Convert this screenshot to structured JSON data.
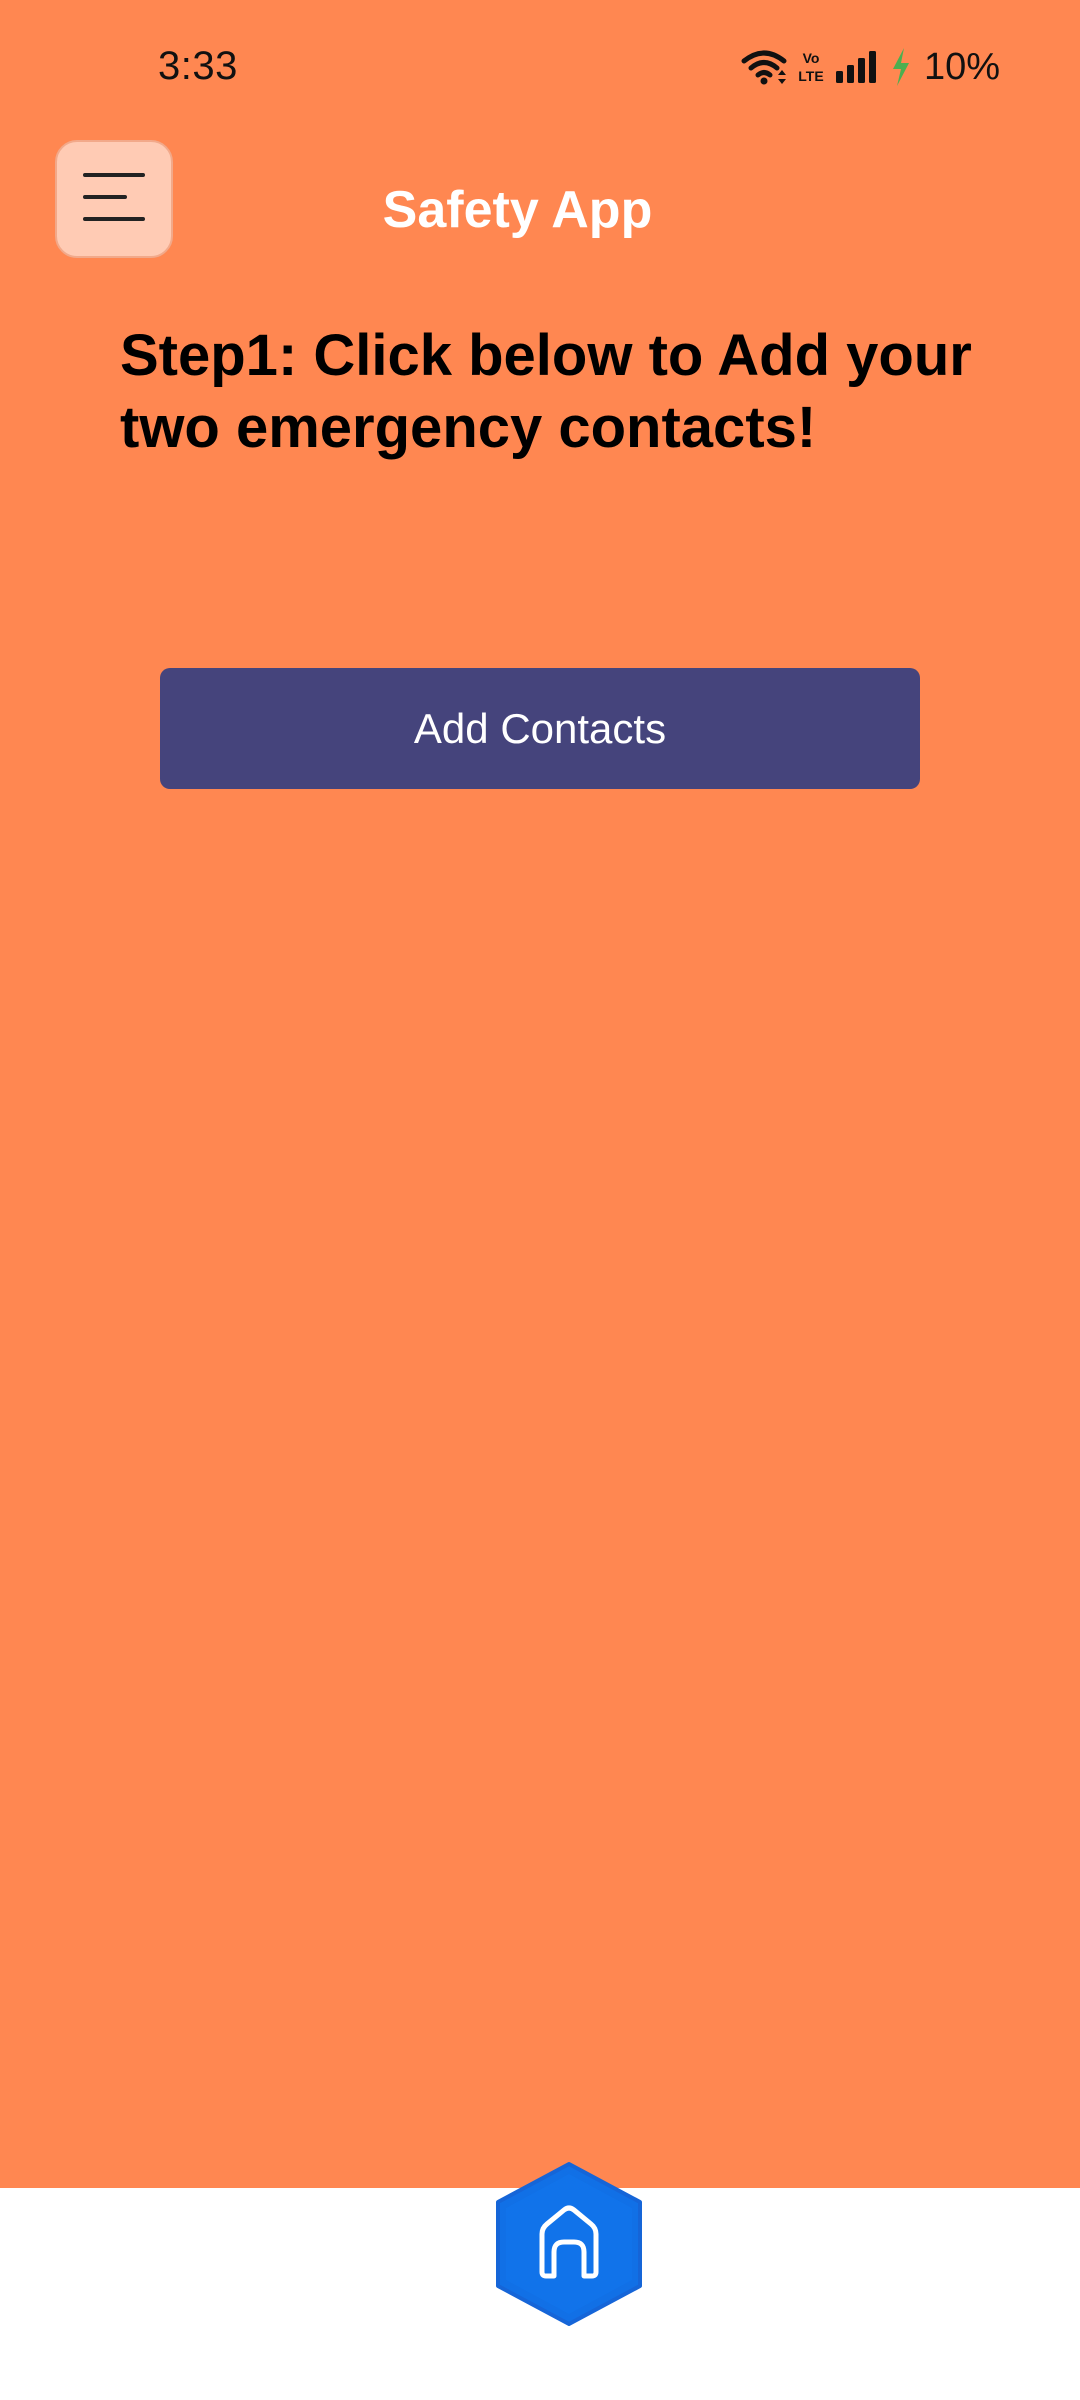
{
  "status_bar": {
    "time": "3:33",
    "battery": "10%",
    "icons": [
      "wifi-icon",
      "volte-icon",
      "signal-icon",
      "charging-bolt-icon"
    ]
  },
  "header": {
    "title": "Safety App",
    "menu_icon": "menu-icon"
  },
  "main": {
    "instruction": "Step1: Click below to Add your two emergency contacts!",
    "add_contacts_label": "Add Contacts"
  },
  "bottom_nav": {
    "home_icon": "home-icon"
  },
  "colors": {
    "background": "#FF8751",
    "button": "#45447C",
    "menu_button": "#FFCBB4",
    "home_button": "#1170E6",
    "bottom_bar": "#FFFFFF"
  }
}
